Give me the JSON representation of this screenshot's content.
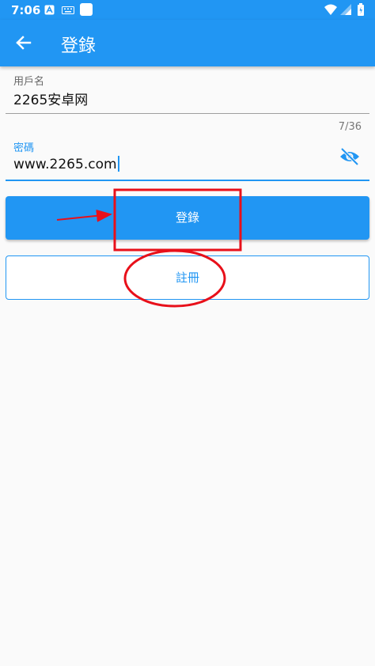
{
  "status_bar": {
    "time": "7:06",
    "left_icons": [
      "a-notification-icon",
      "keyboard-icon",
      "blank-app-icon"
    ],
    "right_icons": [
      "wifi-icon",
      "signal-icon",
      "battery-icon"
    ]
  },
  "app_bar": {
    "title": "登錄",
    "back_icon": "arrow-back-icon"
  },
  "form": {
    "username": {
      "label": "用戶名",
      "value": "2265安卓网"
    },
    "password": {
      "label": "密碼",
      "value": "www.2265.com",
      "counter": "7/36",
      "toggle_icon": "visibility-off-icon"
    }
  },
  "buttons": {
    "login": "登錄",
    "register": "註冊"
  },
  "colors": {
    "primary": "#2196f3",
    "annotation": "#e8101a",
    "background": "#fafafa"
  },
  "annotations": [
    "red-arrow",
    "red-rectangle",
    "red-ellipse"
  ]
}
